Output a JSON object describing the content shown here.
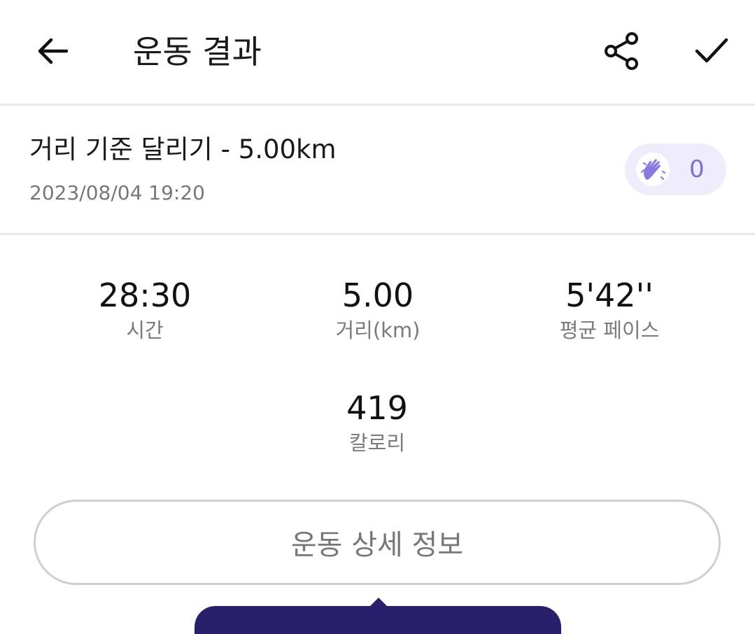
{
  "header": {
    "title": "운동 결과",
    "back_icon": "arrow-left-icon",
    "share_icon": "share-icon",
    "confirm_icon": "check-icon"
  },
  "workout": {
    "title": "거리 기준 달리기 - 5.00km",
    "date": "2023/08/04 19:20",
    "clap_icon": "clapping-hands-icon",
    "clap_count": "0"
  },
  "stats": {
    "time": {
      "value": "28:30",
      "label": "시간"
    },
    "distance": {
      "value": "5.00",
      "label": "거리(km)"
    },
    "pace": {
      "value": "5'42''",
      "label": "평균 페이스"
    },
    "calories": {
      "value": "419",
      "label": "칼로리"
    }
  },
  "actions": {
    "detail_label": "운동 상세 정보"
  },
  "colors": {
    "accent": "#7d6fd4",
    "accent_bg": "#efecfc",
    "tooltip": "#2a1f6b",
    "divider": "#e8e8e8"
  }
}
